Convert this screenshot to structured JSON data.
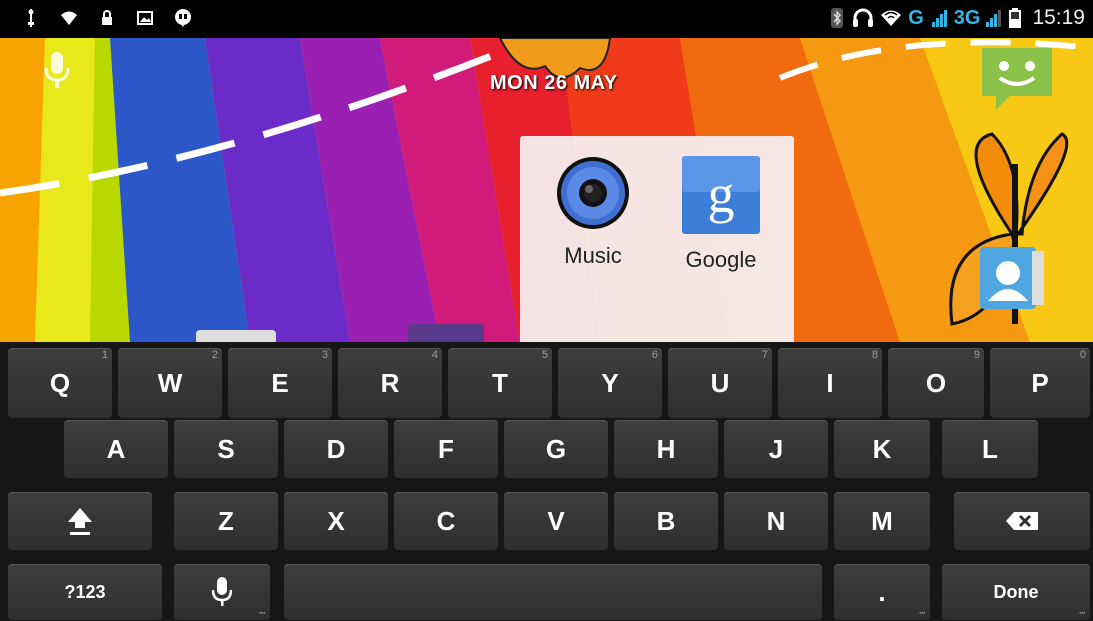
{
  "status_bar": {
    "left_icons": [
      "usb-icon",
      "wifi-alert-icon",
      "lock-icon",
      "image-icon",
      "chat-icon"
    ],
    "right_icons": [
      "bluetooth-icon",
      "headset-icon",
      "wifi-icon"
    ],
    "network_g": "G",
    "network_3g": "3G",
    "time": "15:19"
  },
  "home": {
    "date": "MON 26 MAY",
    "folder": {
      "apps": [
        {
          "label": "Music",
          "icon": "music-speaker-icon"
        },
        {
          "label": "Google",
          "icon": "google-search-icon"
        }
      ]
    },
    "icons": [
      "voice-search-icon",
      "android-app-icon",
      "contacts-icon"
    ]
  },
  "keyboard": {
    "row1": [
      {
        "label": "Q",
        "hint": "1"
      },
      {
        "label": "W",
        "hint": "2"
      },
      {
        "label": "E",
        "hint": "3"
      },
      {
        "label": "R",
        "hint": "4"
      },
      {
        "label": "T",
        "hint": "5"
      },
      {
        "label": "Y",
        "hint": "6"
      },
      {
        "label": "U",
        "hint": "7"
      },
      {
        "label": "I",
        "hint": "8"
      },
      {
        "label": "O",
        "hint": "9"
      },
      {
        "label": "P",
        "hint": "0"
      }
    ],
    "row2": [
      "A",
      "S",
      "D",
      "F",
      "G",
      "H",
      "J",
      "K",
      "L"
    ],
    "row3": [
      "Z",
      "X",
      "C",
      "V",
      "B",
      "N",
      "M"
    ],
    "symbols_label": "?123",
    "period_label": ".",
    "done_label": "Done"
  },
  "colors": {
    "network_accent": "#33b5e5",
    "keyboard_bg": "#161616",
    "key_bg": "#353535"
  }
}
